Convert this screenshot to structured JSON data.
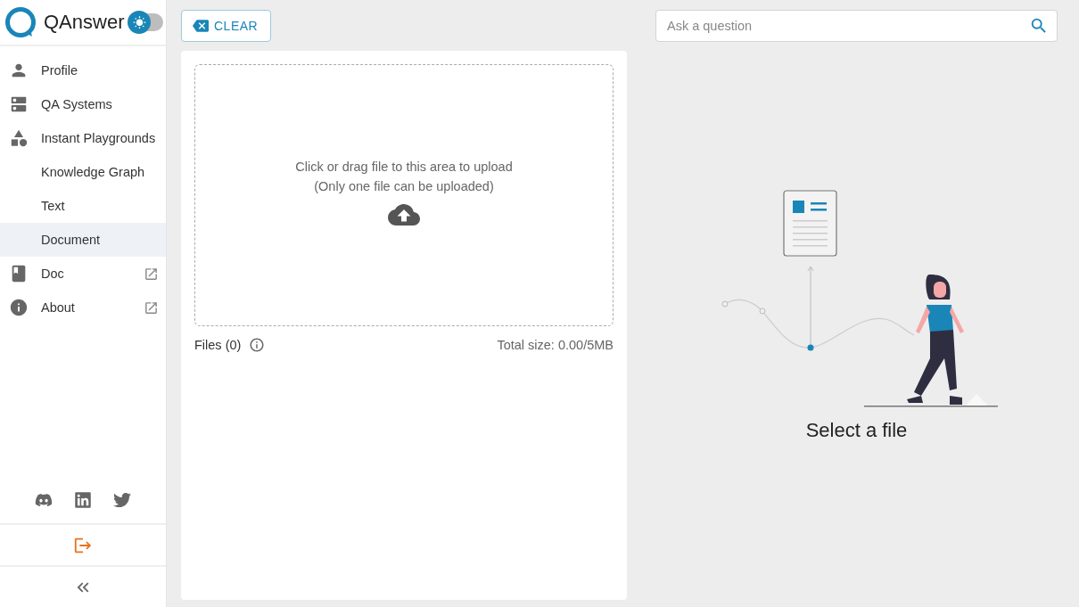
{
  "brand": {
    "name": "QAnswer",
    "theme_toggle": {
      "on": false
    }
  },
  "nav": [
    {
      "label": "Profile",
      "kind": "profile",
      "selected": false,
      "external": false
    },
    {
      "label": "QA Systems",
      "kind": "systems",
      "selected": false,
      "external": false
    },
    {
      "label": "Instant Playgrounds",
      "kind": "playgrounds",
      "selected": false,
      "external": false,
      "children": [
        {
          "label": "Knowledge Graph",
          "selected": false
        },
        {
          "label": "Text",
          "selected": false
        },
        {
          "label": "Document",
          "selected": true
        }
      ]
    },
    {
      "label": "Doc",
      "kind": "doc",
      "selected": false,
      "external": true
    },
    {
      "label": "About",
      "kind": "about",
      "selected": false,
      "external": true
    }
  ],
  "toolbar": {
    "clear_button": "CLEAR"
  },
  "upload": {
    "prompt": "Click or drag file to this area to upload",
    "note": "(Only one file can be uploaded)",
    "files_label": "Files (0)",
    "total_size": "Total size: 0.00/5MB"
  },
  "search": {
    "placeholder": "Ask a question"
  },
  "empty_state": {
    "caption": "Select a file"
  }
}
